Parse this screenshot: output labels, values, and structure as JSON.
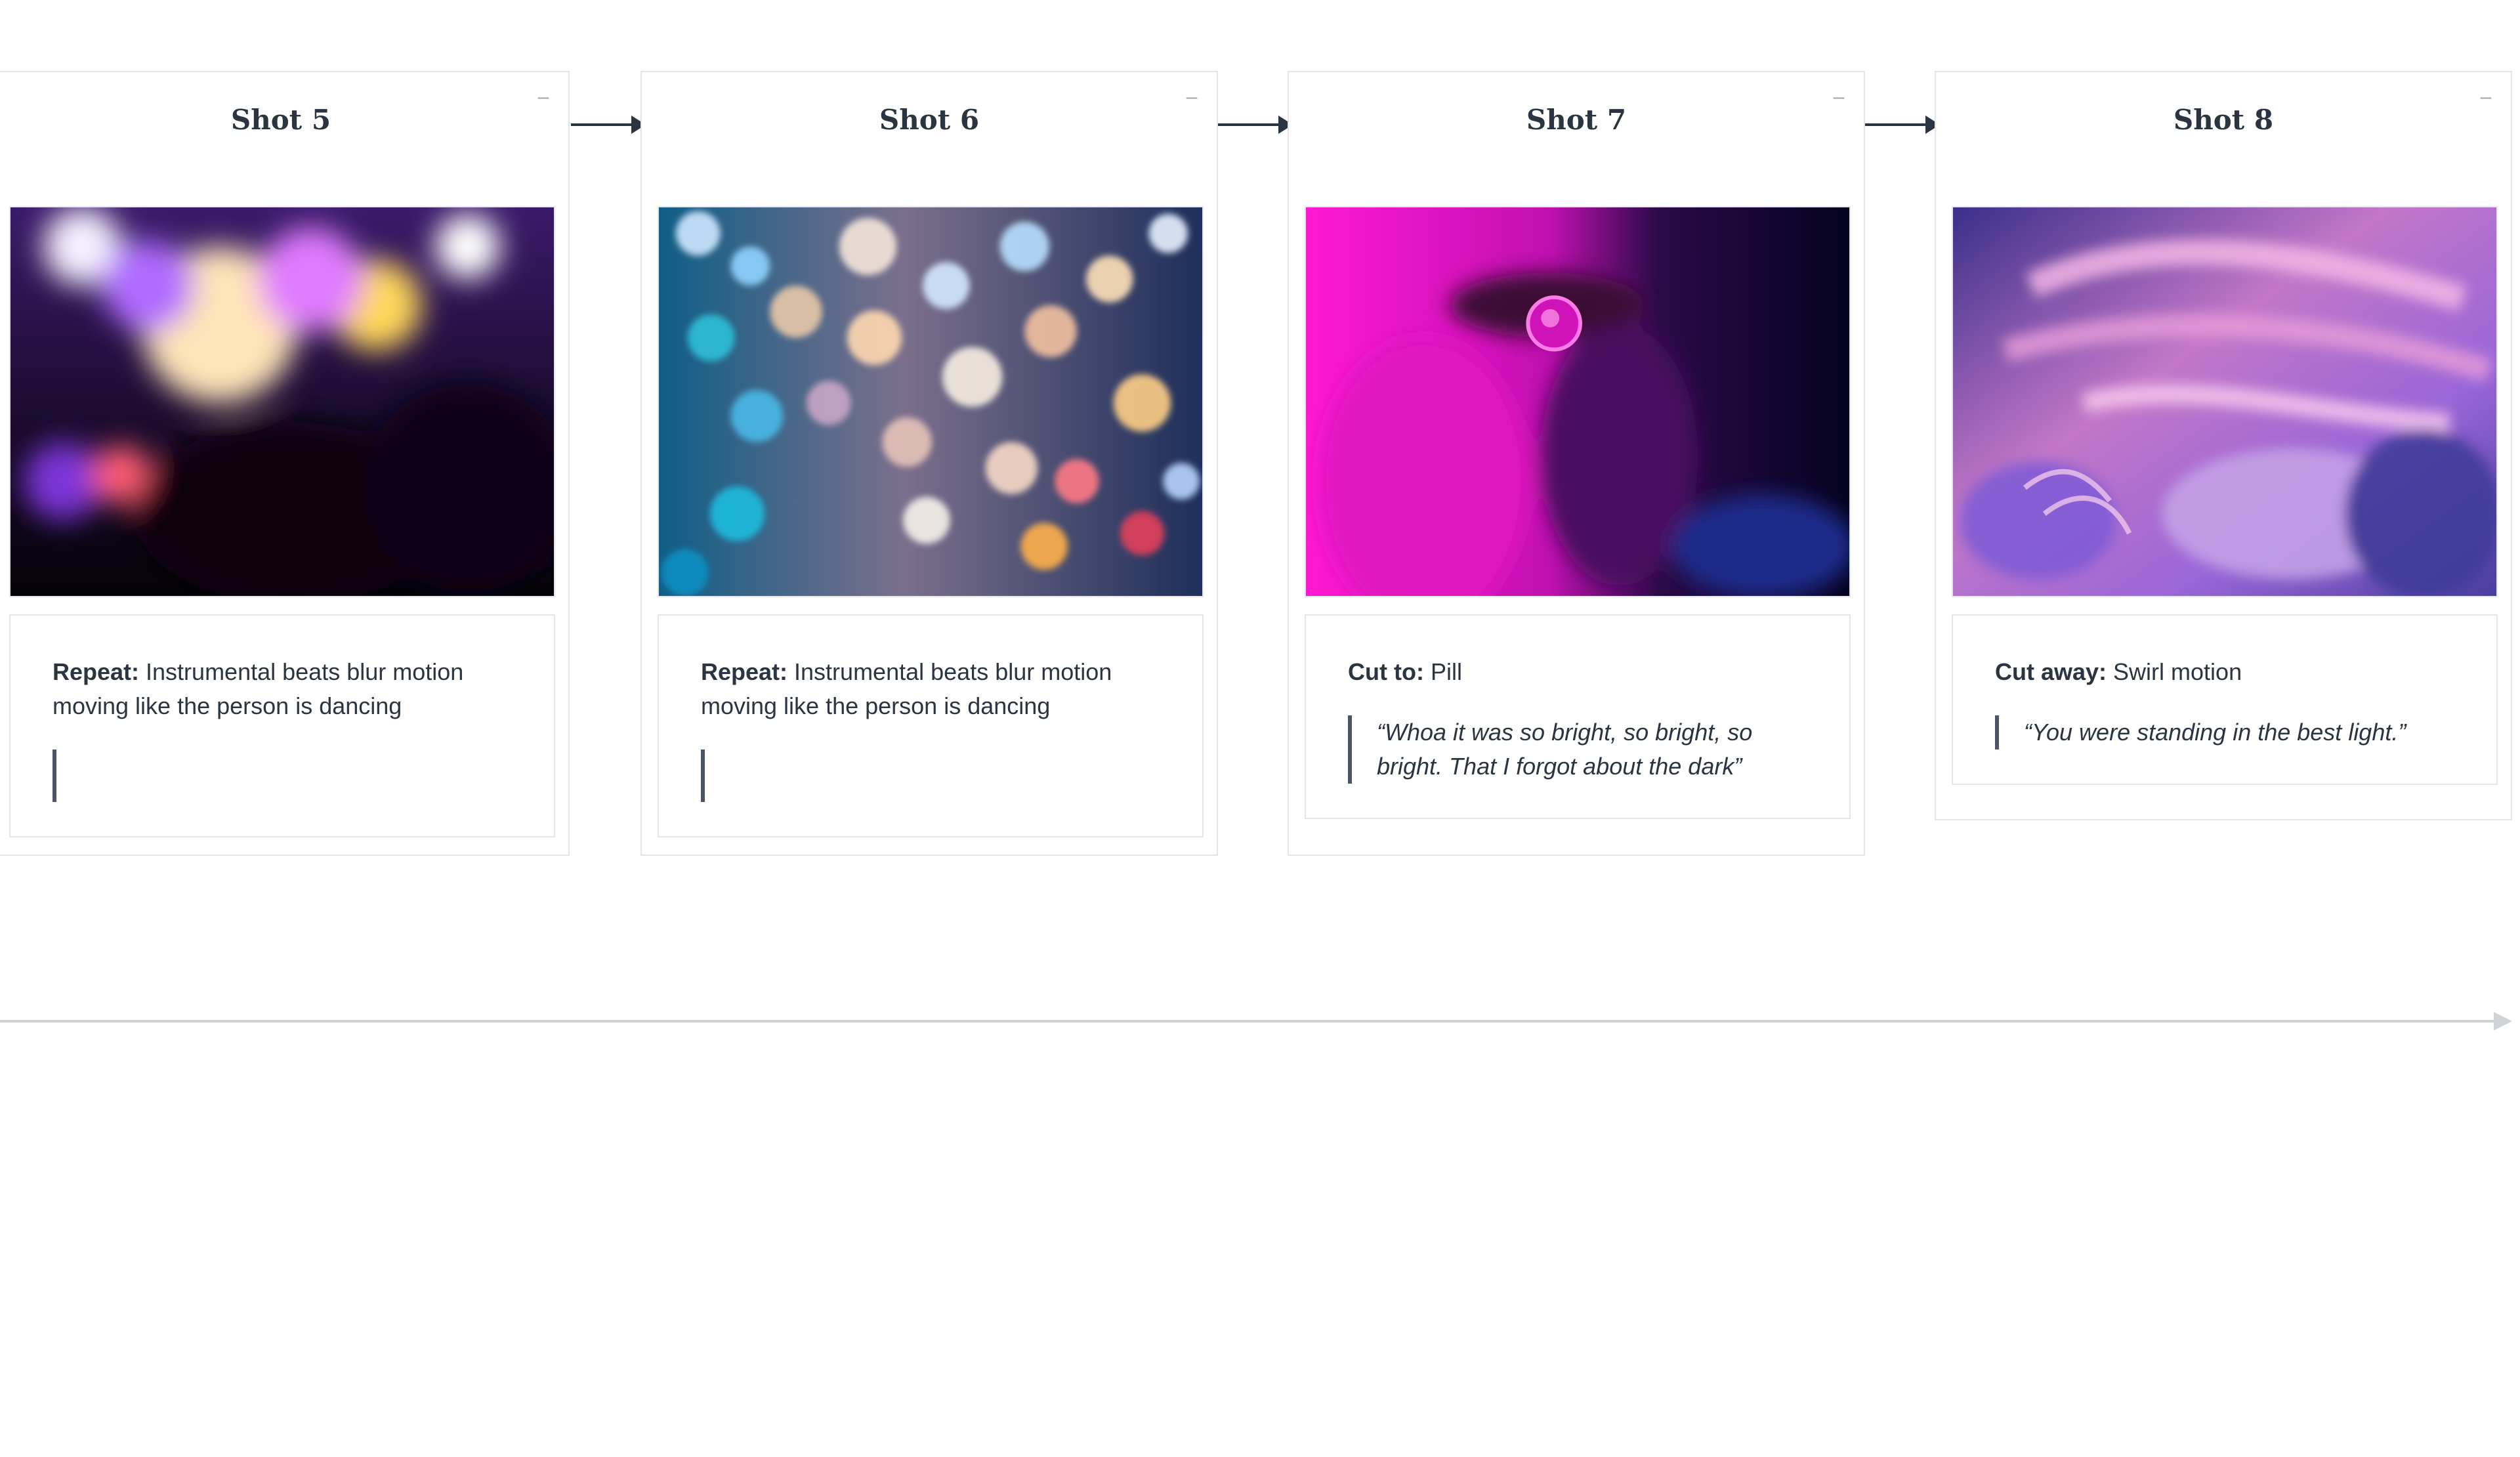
{
  "shots": [
    {
      "title": "Shot 5",
      "collapse_glyph": "–",
      "image_icon": "crowd-bokeh-image",
      "note_label": "Repeat:",
      "note_text": " Instrumental beats blur motion moving like the person is dancing",
      "quote": ""
    },
    {
      "title": "Shot 6",
      "collapse_glyph": "–",
      "image_icon": "colorful-bokeh-image",
      "note_label": "Repeat:",
      "note_text": " Instrumental beats blur motion moving like the person is dancing",
      "quote": ""
    },
    {
      "title": "Shot 7",
      "collapse_glyph": "–",
      "image_icon": "pill-closeup-image",
      "note_label": "Cut to:",
      "note_text": " Pill",
      "quote": "“Whoa it was so bright, so bright, so bright. That I forgot about the dark”"
    },
    {
      "title": "Shot 8",
      "collapse_glyph": "–",
      "image_icon": "swirl-motion-image",
      "note_label": "Cut away:",
      "note_text": " Swirl motion",
      "quote": "“You were standing in the best light.”"
    }
  ],
  "colors": {
    "text": "#2b3441",
    "border": "#e3e5e8",
    "arrow": "#2b3441",
    "timeline": "#cfd3d8"
  }
}
